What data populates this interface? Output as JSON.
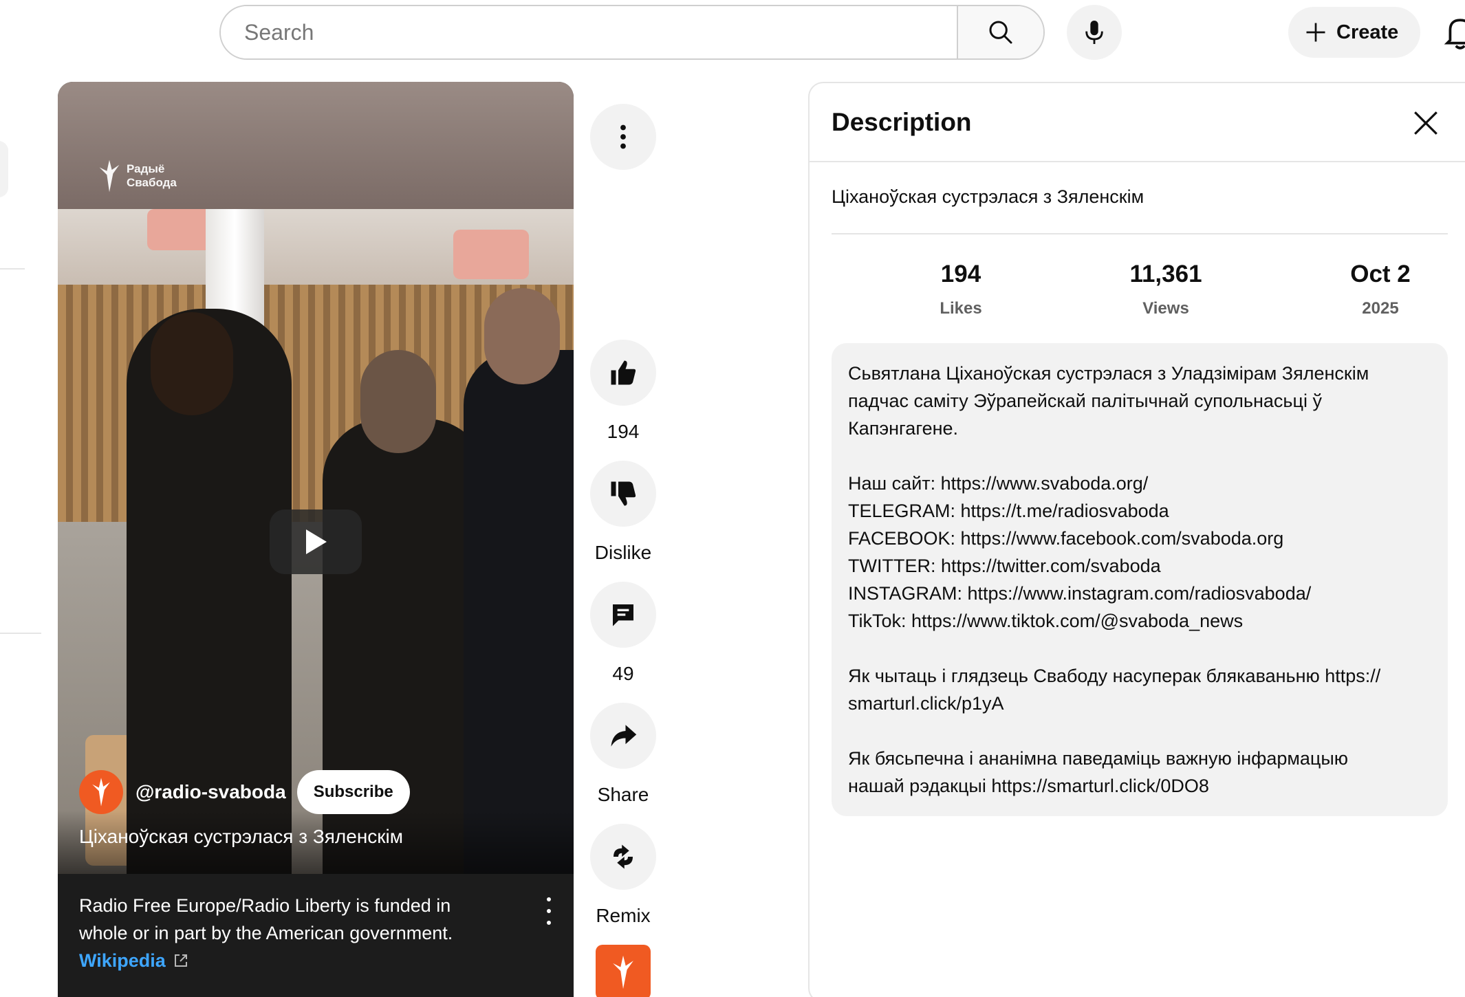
{
  "search": {
    "placeholder": "Search"
  },
  "header": {
    "create_label": "Create"
  },
  "video": {
    "watermark_line1": "Радыё",
    "watermark_line2": "Свабода",
    "channel_handle": "@radio-svaboda",
    "subscribe_label": "Subscribe",
    "title": "Ціханоўская сустрэлася з Зяленскім",
    "info_text": "Radio Free Europe/Radio Liberty is funded in whole or in part by the American government.",
    "info_link": "Wikipedia"
  },
  "actions": {
    "like_count": "194",
    "dislike_label": "Dislike",
    "comment_count": "49",
    "share_label": "Share",
    "remix_label": "Remix"
  },
  "description": {
    "heading": "Description",
    "title": "Ціханоўская сустрэлася з Зяленскім",
    "stats": [
      {
        "value": "194",
        "label": "Likes"
      },
      {
        "value": "11,361",
        "label": "Views"
      },
      {
        "value": "Oct 2",
        "label": "2025"
      }
    ],
    "para1": "Сьвятлана Ціханоўская сустрэлася з Уладзімірам Зяленскім падчас саміту Эўрапейскай палітычнай супольнасьці ў Капэнгагене.",
    "links": [
      "Наш сайт: https://www.svaboda.org/",
      "TELEGRAM: https://t.me/radiosvaboda",
      "FACEBOOK: https://www.facebook.com/svaboda.org",
      "TWITTER: https://twitter.com/svaboda",
      "INSTAGRAM: https://www.instagram.com/radiosvaboda/",
      "TikTok: https://www.tiktok.com/@svaboda_news"
    ],
    "para3": "Як чытаць і глядзець Свабоду насуперак блякаваньню https://\nsmarturl.click/p1yA",
    "para4": "Як бясьпечна і ананімна паведаміць важную інфармацыю\nнашай рэдакцыі https://smarturl.click/0DO8"
  },
  "colors": {
    "brand_orange": "#f05a22",
    "link_blue": "#3ea6ff",
    "chip_gray": "#f2f2f2"
  },
  "icons": [
    "search-icon",
    "mic-icon",
    "plus-icon",
    "bell-icon",
    "more-vert-icon",
    "thumb-up-icon",
    "thumb-down-icon",
    "comment-icon",
    "share-icon",
    "remix-icon",
    "close-icon",
    "external-link-icon",
    "play-icon"
  ]
}
